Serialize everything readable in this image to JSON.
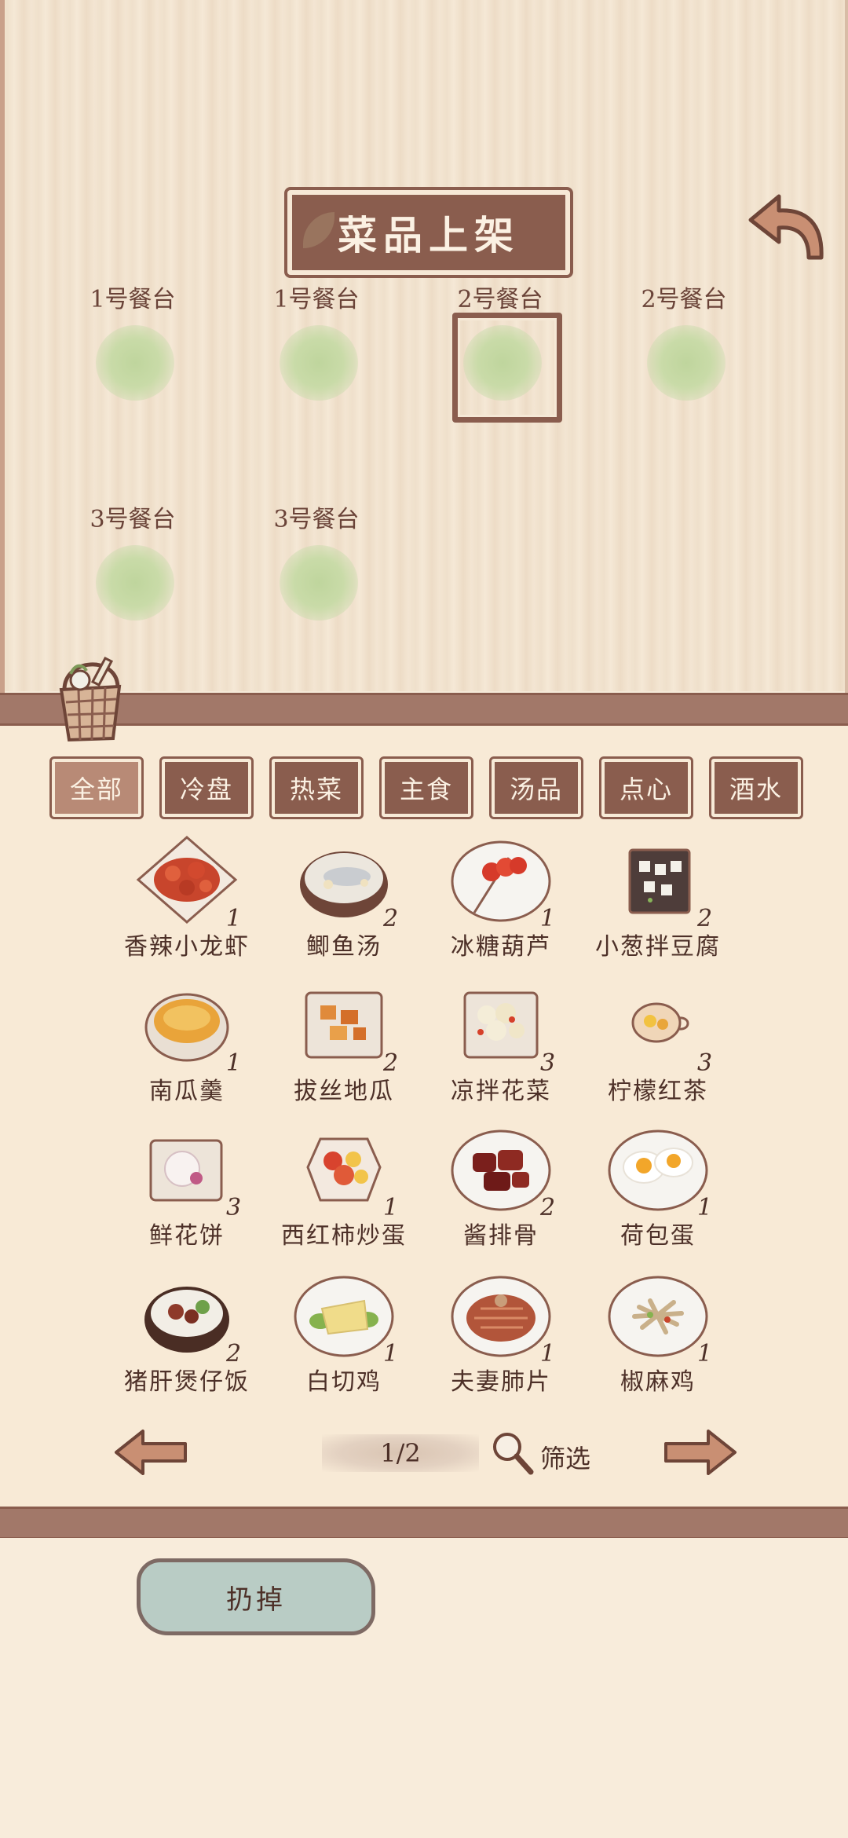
{
  "header": {
    "title": "菜品上架"
  },
  "slots": [
    {
      "label": "1号餐台",
      "selected": false
    },
    {
      "label": "1号餐台",
      "selected": false
    },
    {
      "label": "2号餐台",
      "selected": true
    },
    {
      "label": "2号餐台",
      "selected": false
    },
    {
      "label": "3号餐台",
      "selected": false
    },
    {
      "label": "3号餐台",
      "selected": false
    }
  ],
  "tabs": [
    {
      "label": "全部",
      "active": true
    },
    {
      "label": "冷盘",
      "active": false
    },
    {
      "label": "热菜",
      "active": false
    },
    {
      "label": "主食",
      "active": false
    },
    {
      "label": "汤品",
      "active": false
    },
    {
      "label": "点心",
      "active": false
    },
    {
      "label": "酒水",
      "active": false
    }
  ],
  "dishes": [
    {
      "name": "香辣小龙虾",
      "count": "1",
      "icon": "crayfish-icon"
    },
    {
      "name": "鲫鱼汤",
      "count": "2",
      "icon": "fish-soup-icon"
    },
    {
      "name": "冰糖葫芦",
      "count": "1",
      "icon": "candied-haws-icon"
    },
    {
      "name": "小葱拌豆腐",
      "count": "2",
      "icon": "tofu-icon"
    },
    {
      "name": "南瓜羹",
      "count": "1",
      "icon": "pumpkin-soup-icon"
    },
    {
      "name": "拔丝地瓜",
      "count": "2",
      "icon": "sweet-potato-icon"
    },
    {
      "name": "凉拌花菜",
      "count": "3",
      "icon": "cauliflower-icon"
    },
    {
      "name": "柠檬红茶",
      "count": "3",
      "icon": "lemon-tea-icon"
    },
    {
      "name": "鲜花饼",
      "count": "3",
      "icon": "flower-cake-icon"
    },
    {
      "name": "西红柿炒蛋",
      "count": "1",
      "icon": "tomato-egg-icon"
    },
    {
      "name": "酱排骨",
      "count": "2",
      "icon": "ribs-icon"
    },
    {
      "name": "荷包蛋",
      "count": "1",
      "icon": "fried-egg-icon"
    },
    {
      "name": "猪肝煲仔饭",
      "count": "2",
      "icon": "claypot-rice-icon"
    },
    {
      "name": "白切鸡",
      "count": "1",
      "icon": "chicken-icon"
    },
    {
      "name": "夫妻肺片",
      "count": "1",
      "icon": "beef-slices-icon"
    },
    {
      "name": "椒麻鸡",
      "count": "1",
      "icon": "pepper-chicken-icon"
    }
  ],
  "pagination": {
    "page": "1/2",
    "filter_label": "筛选"
  },
  "footer": {
    "discard_label": "扔掉"
  },
  "colors": {
    "wood_dark": "#8a5d4e",
    "tab_active": "#b88a76",
    "slot_green": "#c9dba8"
  }
}
